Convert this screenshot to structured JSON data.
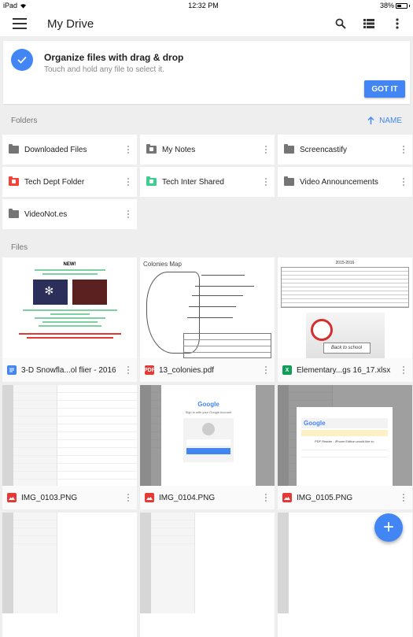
{
  "status_bar": {
    "device": "iPad",
    "time": "12:32 PM",
    "battery": "38%",
    "battery_level": 0.38
  },
  "app_bar": {
    "title": "My Drive",
    "icons": [
      "menu-icon",
      "search-icon",
      "list-view-icon",
      "more-vert-icon"
    ]
  },
  "tip_card": {
    "title": "Organize files with drag & drop",
    "subtitle": "Touch and hold any file to select it.",
    "button": "GOT IT"
  },
  "folders_section": {
    "label": "Folders",
    "sort_label": "NAME",
    "sort_icon": "arrow-up-icon",
    "items": [
      {
        "name": "Downloaded Files",
        "type": "folder",
        "color": "#757575"
      },
      {
        "name": "My Notes",
        "type": "shared-folder",
        "color": "#757575"
      },
      {
        "name": "Screencastify",
        "type": "folder",
        "color": "#757575"
      },
      {
        "name": "Tech Dept Folder",
        "type": "shared-folder",
        "color": "#f44336"
      },
      {
        "name": "Tech Inter Shared",
        "type": "shared-folder",
        "color": "#3ecf8e"
      },
      {
        "name": "Video Announcements",
        "type": "folder",
        "color": "#757575"
      },
      {
        "name": "VideoNot.es",
        "type": "folder",
        "color": "#757575"
      }
    ]
  },
  "files_section": {
    "label": "Files",
    "items": [
      {
        "name": "3-D Snowfla...ol flier - 2016",
        "type": "doc",
        "badge": "",
        "color": "#4285f4",
        "thumb_text": "NEW!"
      },
      {
        "name": "13_colonies.pdf",
        "type": "pdf",
        "badge": "PDF",
        "color": "#e53935",
        "thumb_text": "Colonies Map"
      },
      {
        "name": "Elementary...gs 16_17.xlsx",
        "type": "sheet",
        "badge": "X",
        "color": "#0f9d58",
        "thumb_text": "2015-2016",
        "thumb_sign": "Back to school"
      },
      {
        "name": "IMG_0103.PNG",
        "type": "image",
        "badge": "",
        "color": "#e53935"
      },
      {
        "name": "IMG_0104.PNG",
        "type": "image",
        "badge": "",
        "color": "#e53935",
        "thumb_text": "Google",
        "thumb_sub": "Sign in with your Google Account"
      },
      {
        "name": "IMG_0105.PNG",
        "type": "image",
        "badge": "",
        "color": "#e53935",
        "thumb_text": "Google",
        "thumb_sub": "PDF Reader - iPhone Edition would like to:"
      }
    ]
  },
  "fab": {
    "label": "+",
    "icon": "add-icon"
  },
  "colors": {
    "accent": "#4285f4",
    "background": "#eeeeee"
  }
}
